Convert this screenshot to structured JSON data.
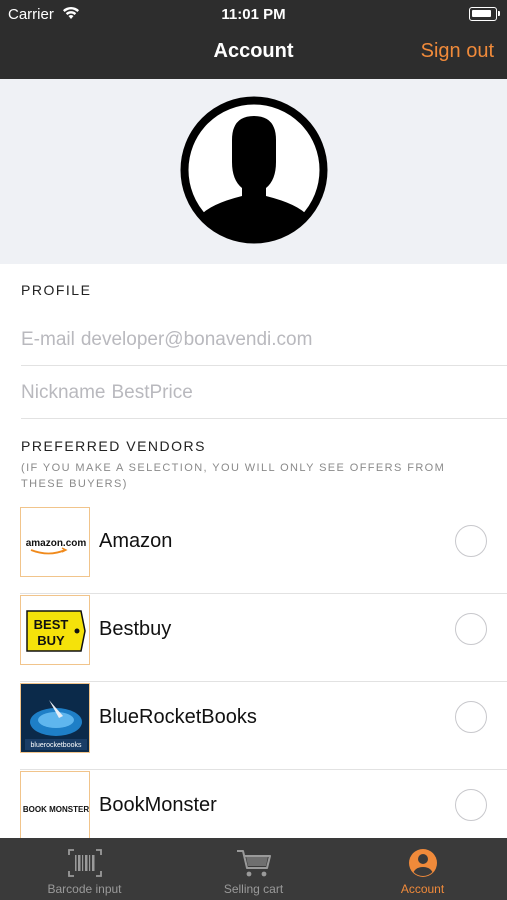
{
  "status_bar": {
    "carrier": "Carrier",
    "time": "11:01 PM"
  },
  "nav": {
    "title": "Account",
    "sign_out": "Sign out"
  },
  "profile": {
    "header": "PROFILE",
    "email_label": "E-mail",
    "email_value": "developer@bonavendi.com",
    "nickname_label": "Nickname",
    "nickname_value": "BestPrice"
  },
  "vendors": {
    "header": "PREFERRED VENDORS",
    "note": "(IF YOU MAKE A SELECTION, YOU WILL ONLY SEE OFFERS FROM THESE BUYERS)",
    "items": [
      {
        "name": "Amazon",
        "logo_text": "amazon.com",
        "selected": false
      },
      {
        "name": "Bestbuy",
        "logo_text": "BEST BUY",
        "selected": false
      },
      {
        "name": "BlueRocketBooks",
        "logo_text": "bluerocketbooks",
        "selected": false
      },
      {
        "name": "BookMonster",
        "logo_text": "BOOK MONSTER",
        "selected": false
      }
    ]
  },
  "tabs": [
    {
      "label": "Barcode input",
      "icon": "barcode-icon",
      "active": false
    },
    {
      "label": "Selling cart",
      "icon": "cart-icon",
      "active": false
    },
    {
      "label": "Account",
      "icon": "account-icon",
      "active": true
    }
  ],
  "colors": {
    "accent": "#f08a3a",
    "bar": "#2d2d2d",
    "tabbar": "#3a3a3a"
  }
}
